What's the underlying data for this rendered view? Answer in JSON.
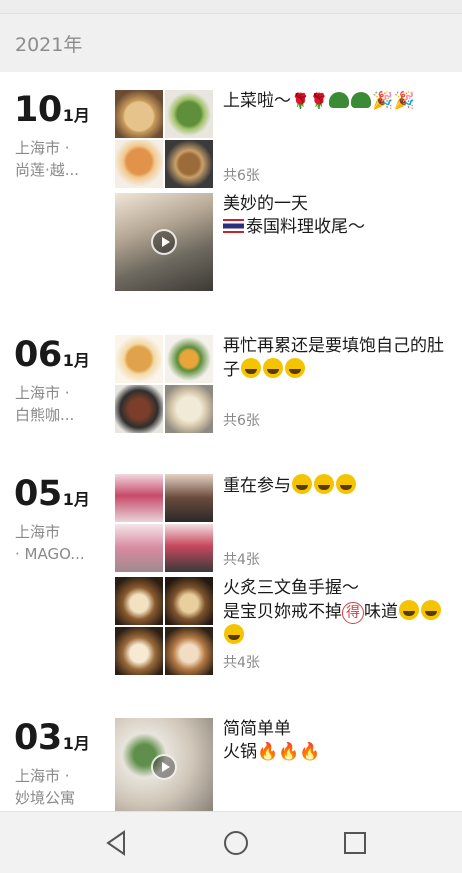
{
  "year": "2021年",
  "colors": {
    "year_bar": "#f0f0f0",
    "secondary_text": "#8a8a8a",
    "nav_bar": "#f2f2f2"
  },
  "entries": [
    {
      "day": "10",
      "month": "1月",
      "location": [
        "上海市 ·",
        "尚莲·越..."
      ],
      "posts": [
        {
          "type": "photos",
          "text": [
            "上菜啦～"
          ],
          "emoji_after": [
            "rose",
            "rose",
            "turtle",
            "turtle",
            "party",
            "party"
          ],
          "count": "共6张"
        },
        {
          "type": "video",
          "text": [
            "美妙的一天",
            "泰国料理收尾～"
          ],
          "flag": "thailand-flag"
        }
      ]
    },
    {
      "day": "06",
      "month": "1月",
      "location": [
        "上海市 ·",
        "白熊咖..."
      ],
      "posts": [
        {
          "type": "photos",
          "text": [
            "再忙再累还是要填饱自己的肚",
            "子"
          ],
          "emoji_after": [
            "laugh-cry",
            "laugh-cry",
            "laugh-cry"
          ],
          "count": "共6张"
        }
      ]
    },
    {
      "day": "05",
      "month": "1月",
      "location": [
        "上海市",
        "· MAGO..."
      ],
      "posts": [
        {
          "type": "photos",
          "text": [
            "重在参与"
          ],
          "emoji_after": [
            "laugh-cry",
            "laugh-cry",
            "laugh-cry"
          ],
          "count": "共4张"
        },
        {
          "type": "photos",
          "text": [
            "火炙三文鱼手握～",
            "是宝贝妳戒不掉",
            "味道"
          ],
          "circled": "得",
          "emoji_after": [
            "laugh-cry",
            "laugh-cry",
            "laugh-cry"
          ],
          "count": "共4张"
        }
      ]
    },
    {
      "day": "03",
      "month": "1月",
      "location": [
        "上海市 ·",
        "妙境公寓"
      ],
      "posts": [
        {
          "type": "video",
          "text": [
            "简简单单",
            "火锅"
          ],
          "emoji_after": [
            "fire",
            "fire",
            "fire"
          ]
        }
      ]
    }
  ],
  "nav": {
    "back": "back-triangle",
    "home": "home-circle",
    "recents": "recents-square"
  }
}
